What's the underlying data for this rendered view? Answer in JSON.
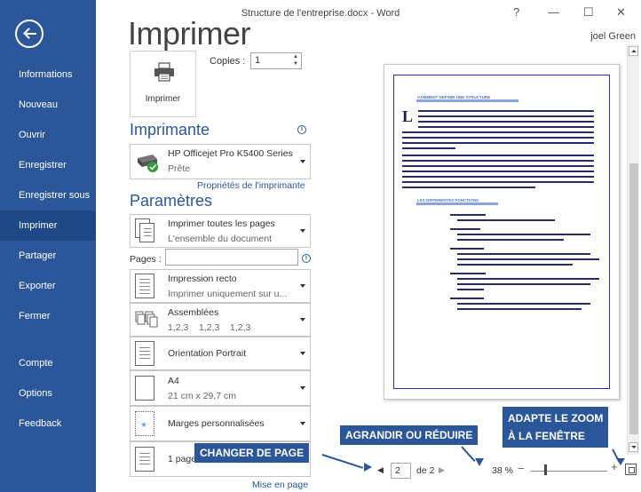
{
  "window": {
    "title": "Structure de l'entreprise.docx - Word",
    "help": "?",
    "minimize": "—",
    "maximize": "☐",
    "close": "✕",
    "user": "joel Green"
  },
  "sidebar": {
    "items": [
      {
        "label": "Informations"
      },
      {
        "label": "Nouveau"
      },
      {
        "label": "Ouvrir"
      },
      {
        "label": "Enregistrer"
      },
      {
        "label": "Enregistrer sous"
      },
      {
        "label": "Imprimer"
      },
      {
        "label": "Partager"
      },
      {
        "label": "Exporter"
      },
      {
        "label": "Fermer"
      },
      {
        "label": "Compte"
      },
      {
        "label": "Options"
      },
      {
        "label": "Feedback"
      }
    ],
    "active": "Imprimer",
    "accent": "#2b579a"
  },
  "main": {
    "title": "Imprimer",
    "print_button": "Imprimer",
    "copies_label": "Copies :",
    "copies_value": "1",
    "printer_heading": "Imprimante",
    "printer_name": "HP Officejet Pro K5400 Series",
    "printer_status": "Prête",
    "printer_properties": "Propriétés de l'imprimante",
    "settings_heading": "Paramètres",
    "settings": {
      "range_line1": "Imprimer toutes les pages",
      "range_line2": "L'ensemble du document",
      "pages_label": "Pages :",
      "sides_line1": "Impression recto",
      "sides_line2": "Imprimer uniquement sur u...",
      "collate_line1": "Assemblées",
      "collate_line2": "1,2,3    1,2,3    1,2,3",
      "orientation": "Orientation Portrait",
      "paper_line1": "A4",
      "paper_line2": "21 cm x 29,7 cm",
      "margins": "Marges personnalisées",
      "per_sheet": "1 page"
    },
    "page_setup": "Mise en page"
  },
  "preview": {
    "heading1": "COMMENT DEFINIR UNE STRUCTURE",
    "heading2": "LES DIFFERENTES FONCTIONS",
    "dropcap": "L",
    "current_page": "2",
    "of_pages": "de 2",
    "zoom": "38 %",
    "prev_icon": "arrow-left-icon",
    "next_icon": "arrow-right-icon"
  },
  "annotations": {
    "change_page": "CHANGER DE PAGE",
    "zoom": "AGRANDIR OU RÉDUIRE",
    "fit_line1": "ADAPTE LE ZOOM",
    "fit_line2": "À LA FENÊTRE",
    "color": "#2b579a"
  }
}
